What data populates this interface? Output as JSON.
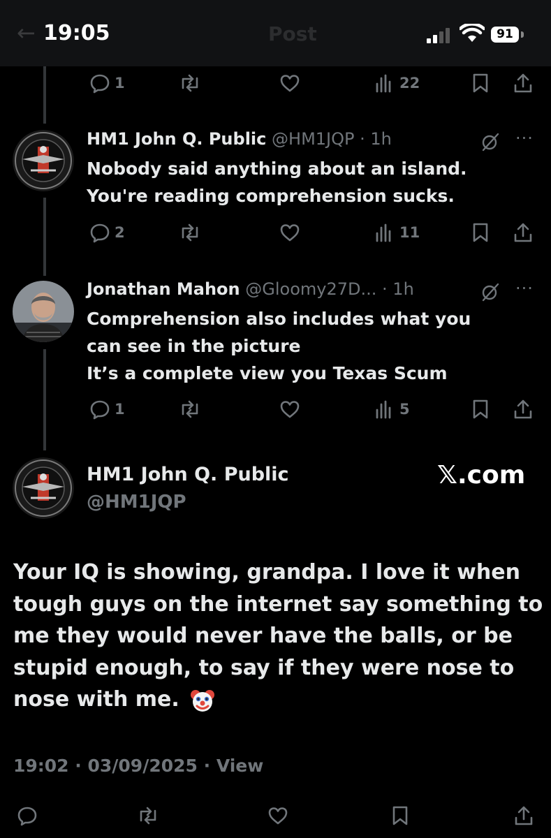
{
  "status_bar": {
    "time": "19:05",
    "battery": "91"
  },
  "header": {
    "title": "Post"
  },
  "top_actions": {
    "replies": "1",
    "reposts": "",
    "likes": "",
    "views": "22"
  },
  "replies": [
    {
      "name": "HM1 John Q. Public",
      "handle": "@HM1JQP",
      "time": "· 1h",
      "lines": [
        "Nobody said anything about an island.",
        "You're reading comprehension sucks."
      ],
      "replies": "2",
      "views": "11"
    },
    {
      "name": "Jonathan Mahon",
      "handle": "@Gloomy27D...",
      "time": "· 1h",
      "lines": [
        "Comprehension also includes what you",
        "can see in the picture",
        "It’s a complete view you Texas Scum"
      ],
      "replies": "1",
      "views": "5"
    }
  ],
  "main_post": {
    "name": "HM1 John Q. Public",
    "handle": "@HM1JQP",
    "watermark": "𝕏.com",
    "lines": [
      "Your IQ is showing, grandpa. I love it when",
      "tough guys on the internet say something to",
      "me they would never have the balls, or be",
      "stupid enough, to say if they were nose to",
      "nose with me."
    ],
    "timestamp": "19:02 · 03/09/2025 · ",
    "view_label": "View"
  },
  "icons": [
    "reply-icon",
    "repost-icon",
    "like-icon",
    "views-icon",
    "bookmark-icon",
    "share-icon",
    "grok-icon",
    "more-icon",
    "clown-emoji"
  ]
}
